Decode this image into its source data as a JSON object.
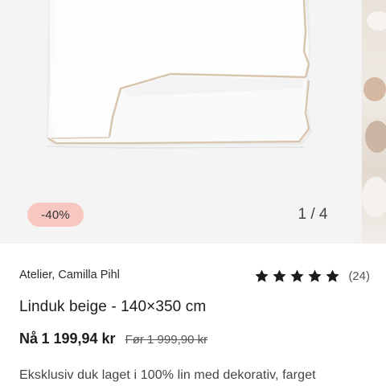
{
  "gallery": {
    "discount_badge": "-40%",
    "counter": "1 / 4"
  },
  "product": {
    "brand": "Atelier, Camilla Pihl",
    "rating": 5,
    "review_count": "(24)",
    "title": "Linduk beige - 140×350 cm",
    "price_prefix": "Nå",
    "price_now": "1 199,94 kr",
    "price_before": "Før 1 999,90 kr",
    "description": "Eksklusiv duk laget i 100% lin med dekorativ, farget"
  },
  "colors": {
    "badge_bg": "#f7c7c0",
    "piping": "#d8c4ad",
    "star": "#1c1c1c"
  },
  "icons": {
    "star": "star-icon"
  }
}
